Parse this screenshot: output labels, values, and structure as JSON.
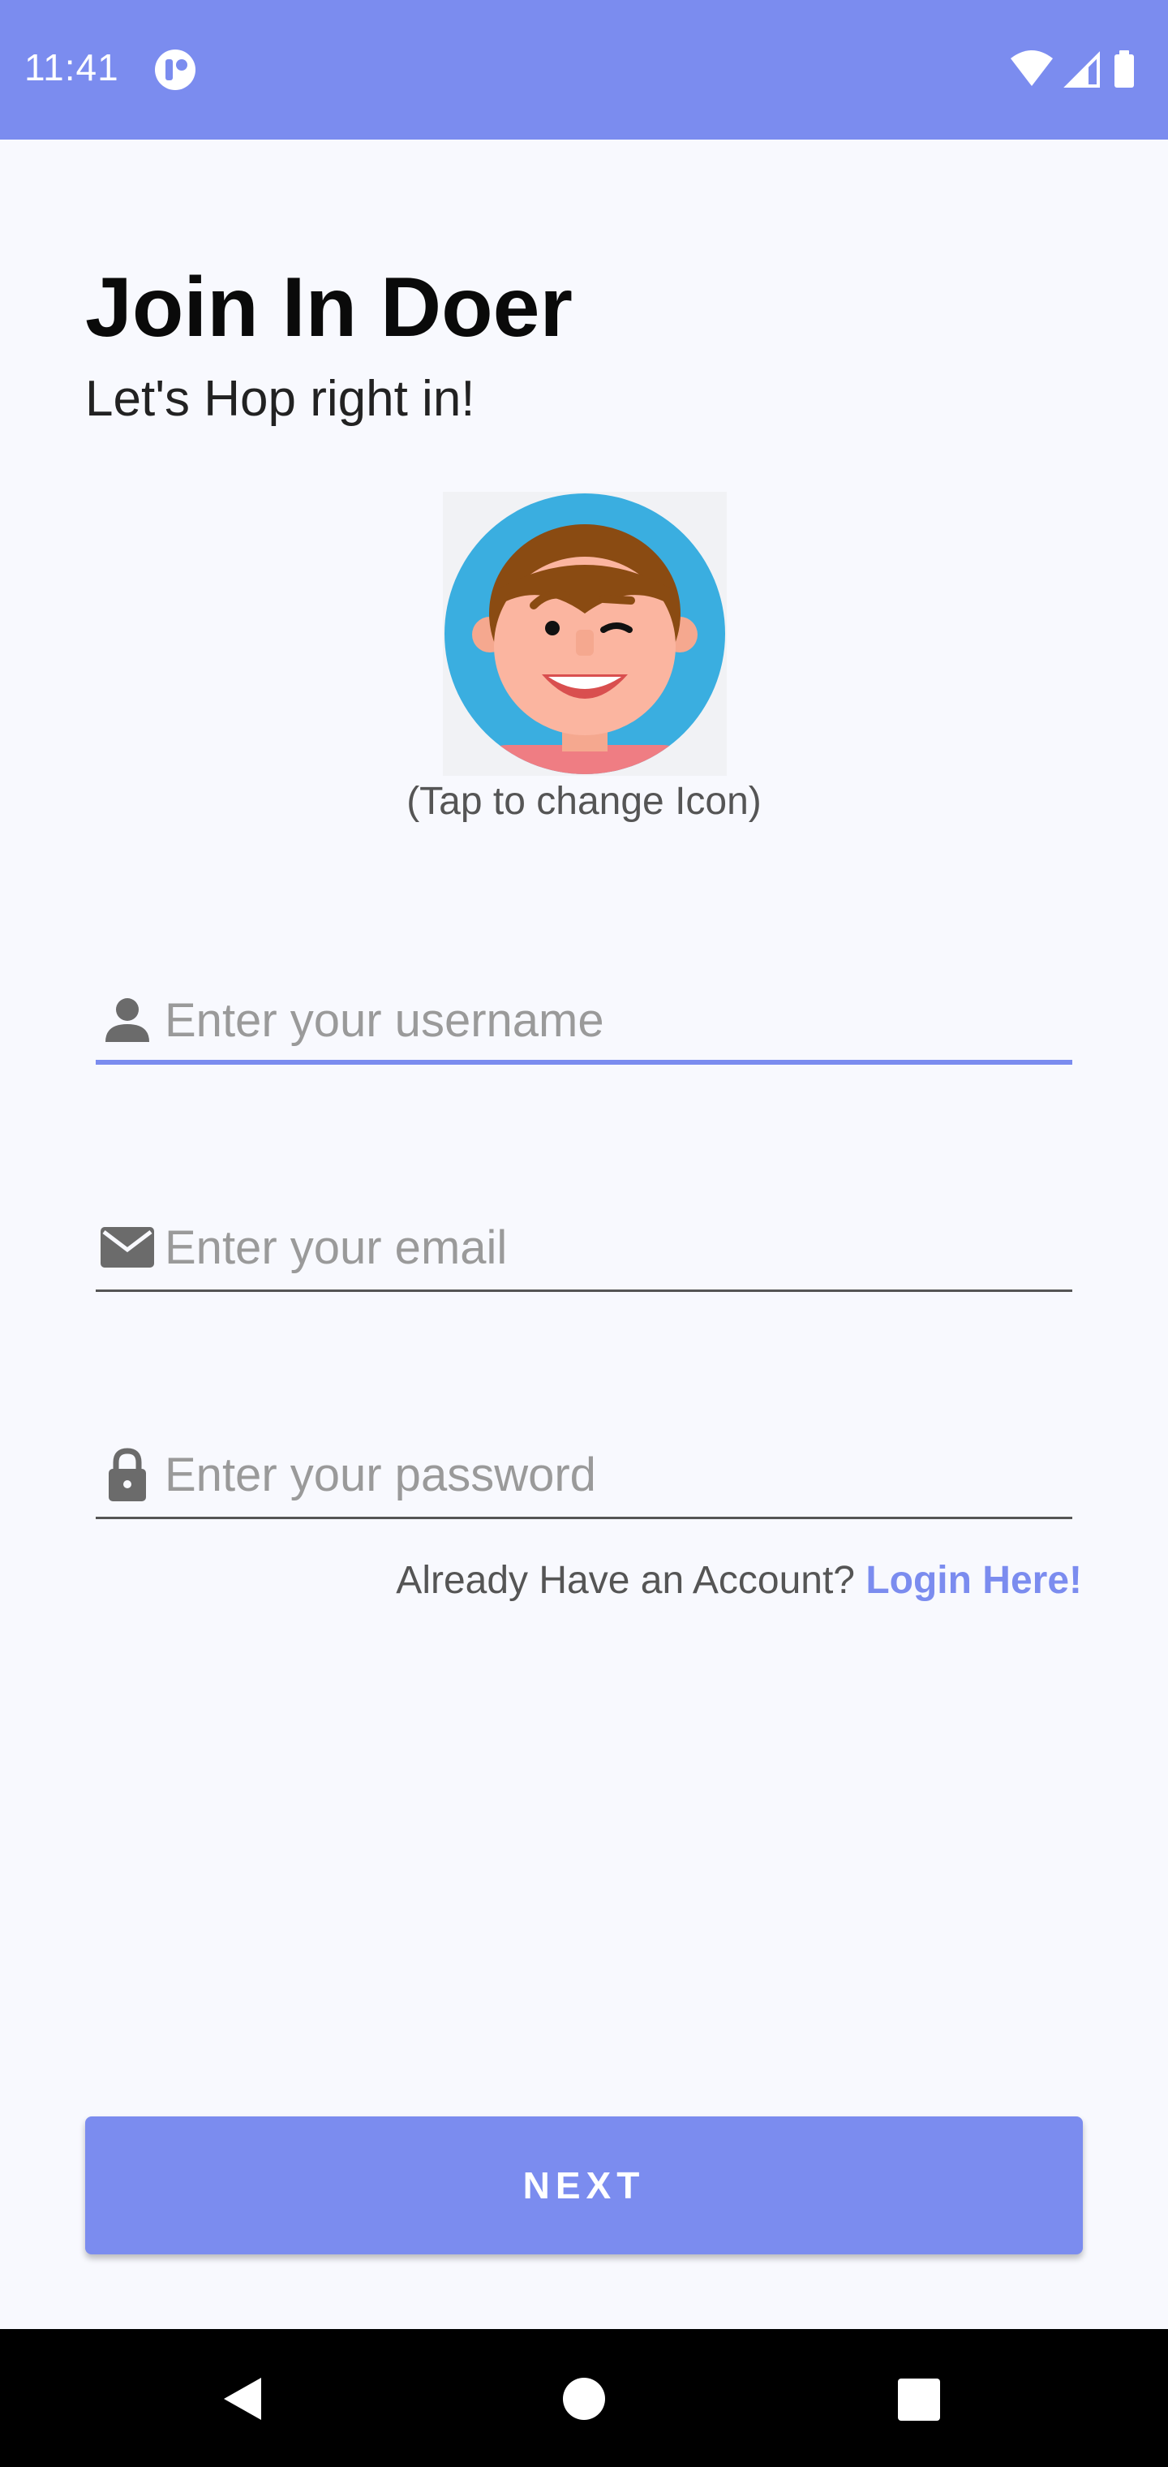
{
  "status_bar": {
    "time": "11:41",
    "app_icon": "circle-badge-icon",
    "icons": [
      "wifi-icon",
      "cell-signal-icon",
      "battery-icon"
    ],
    "color": "#7b8cef"
  },
  "header": {
    "title": "Join In Doer",
    "subtitle": "Let's Hop right in!"
  },
  "avatar": {
    "icon": "cartoon-avatar",
    "hint": "(Tap to change Icon)"
  },
  "form": {
    "username": {
      "placeholder": "Enter your username",
      "value": "",
      "icon": "person-icon"
    },
    "email": {
      "placeholder": "Enter your email",
      "value": "",
      "icon": "mail-icon"
    },
    "password": {
      "placeholder": "Enter your password",
      "value": "",
      "icon": "lock-icon"
    }
  },
  "login_prompt": {
    "text": "Already Have an Account? ",
    "link": "Login Here!"
  },
  "next_button": {
    "label": "NEXT"
  },
  "nav_bar": {
    "buttons": [
      "back-triangle-icon",
      "home-circle-icon",
      "recents-square-icon"
    ]
  },
  "colors": {
    "accent": "#7b8cef",
    "background": "#f8f9fe"
  }
}
